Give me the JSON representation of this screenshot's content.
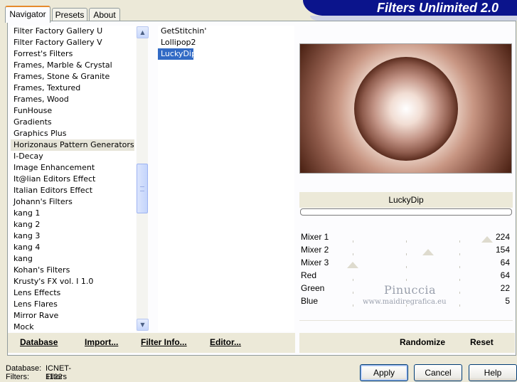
{
  "tabs": [
    {
      "label": "Navigator",
      "active": true
    },
    {
      "label": "Presets",
      "active": false
    },
    {
      "label": "About",
      "active": false
    }
  ],
  "header": {
    "title": "Filters Unlimited 2.0"
  },
  "categories": {
    "items": [
      "Filter Factory Gallery U",
      "Filter Factory Gallery V",
      "Forrest's Filters",
      "Frames, Marble & Crystal",
      "Frames, Stone & Granite",
      "Frames, Textured",
      "Frames, Wood",
      "FunHouse",
      "Gradients",
      "Graphics Plus",
      "Horizonaus Pattern Generators",
      "I-Decay",
      "Image Enhancement",
      "It@lian Editors Effect",
      "Italian Editors Effect",
      "Johann's Filters",
      "kang 1",
      "kang 2",
      "kang 3",
      "kang 4",
      "kang",
      "Kohan's Filters",
      "Krusty's FX vol. I 1.0",
      "Lens Effects",
      "Lens Flares",
      "Mirror Rave",
      "Mock"
    ],
    "highlighted": "Horizonaus Pattern Generators"
  },
  "filters": {
    "items": [
      "GetStitchin'",
      "Lollipop2",
      "LuckyDip"
    ],
    "selected": "LuckyDip"
  },
  "toolbar_left": {
    "database": "Database",
    "import": "Import...",
    "filter_info": "Filter Info...",
    "editor": "Editor..."
  },
  "preview": {
    "filter_name": "LuckyDip"
  },
  "sliders": [
    {
      "label": "Mixer 1",
      "value": "224",
      "level": 224
    },
    {
      "label": "Mixer 2",
      "value": "154",
      "level": 154
    },
    {
      "label": "Mixer 3",
      "value": "64",
      "level": 64
    },
    {
      "label": "Red",
      "value": "64",
      "level": null
    },
    {
      "label": "Green",
      "value": "22",
      "level": null
    },
    {
      "label": "Blue",
      "value": "5",
      "level": null
    }
  ],
  "watermark": {
    "line1": "Pinuccia",
    "line2": "www.maidiregrafica.eu"
  },
  "toolbar_right": {
    "randomize": "Randomize",
    "reset": "Reset"
  },
  "status": {
    "database_label": "Database:",
    "database_value": "ICNET-Filters",
    "filters_label": "Filters:",
    "filters_value": "1122"
  },
  "dialog_buttons": {
    "apply": "Apply",
    "cancel": "Cancel",
    "help": "Help"
  }
}
